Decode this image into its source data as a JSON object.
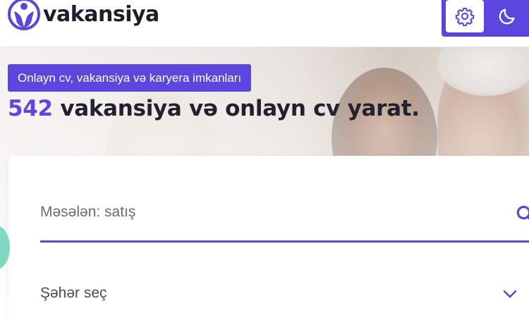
{
  "header": {
    "brand": "vakansiya",
    "logo_icon": "person-tie-logo-icon",
    "theme_toggle": {
      "light_icon": "gear-icon",
      "dark_icon": "moon-icon",
      "accent": "#5b46e0"
    }
  },
  "hero": {
    "tagline": "Onlayn cv, vakansiya və karyera imkanları",
    "vacancy_count": "542",
    "headline_rest": "vakansiya və onlayn cv yarat."
  },
  "search": {
    "placeholder": "Məsələn: satış",
    "icon": "search-icon",
    "city_label": "Şəhər seç",
    "city_icon": "chevron-down-icon"
  },
  "colors": {
    "accent": "#5b46e0",
    "text": "#22222e",
    "side_badge": "#7fd9c1"
  }
}
